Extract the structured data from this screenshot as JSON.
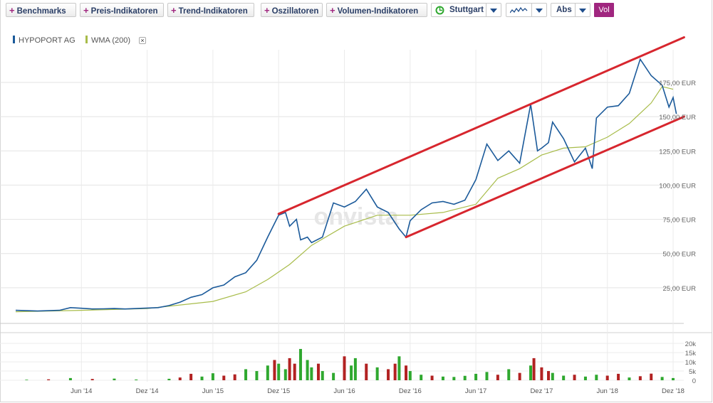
{
  "toolbar": {
    "benchmarks": "Benchmarks",
    "preis": "Preis-Indikatoren",
    "trend": "Trend-Indikatoren",
    "oszillatoren": "Oszillatoren",
    "volumen": "Volumen-Indikatoren",
    "exchange": "Stuttgart",
    "scale": "Abs",
    "vol": "Vol",
    "chart_type_icon": "line-chart-icon",
    "exchange_icon": "refresh-icon"
  },
  "legend": {
    "stock": "HYPOPORT AG",
    "wma": "WMA (200)",
    "remove": "×"
  },
  "watermark": "onvista",
  "colors": {
    "stock": "#1b5a9a",
    "wma": "#a8bc4a",
    "channel": "#d7262e",
    "vol_up": "#2fa82f",
    "vol_down": "#b22222",
    "accent": "#a0267f"
  },
  "chart_data": {
    "type": "line",
    "currency": "EUR",
    "y_ticks": [
      "25,00 EUR",
      "50,00 EUR",
      "75,00 EUR",
      "100,00 EUR",
      "125,00 EUR",
      "150,00 EUR",
      "175,00 EUR"
    ],
    "ylim": [
      0,
      175
    ],
    "x_ticks": [
      "Jun '14",
      "Dez '14",
      "Jun '15",
      "Dez '15",
      "Jun '16",
      "Dez '16",
      "Jun '17",
      "Dez '17",
      "Jun '18",
      "Dez '18"
    ],
    "xlim": [
      "2013-12",
      "2018-12"
    ],
    "series": [
      {
        "name": "HYPOPORT AG",
        "points": [
          [
            "2013-12",
            8.5
          ],
          [
            "2014-02",
            8.0
          ],
          [
            "2014-04",
            8.5
          ],
          [
            "2014-05",
            10.5
          ],
          [
            "2014-06",
            10
          ],
          [
            "2014-07",
            9.5
          ],
          [
            "2014-08",
            9.6
          ],
          [
            "2014-09",
            9.8
          ],
          [
            "2014-10",
            9.5
          ],
          [
            "2014-11",
            9.8
          ],
          [
            "2015-01",
            10.5
          ],
          [
            "2015-02",
            12
          ],
          [
            "2015-03",
            14.5
          ],
          [
            "2015-04",
            18
          ],
          [
            "2015-05",
            20
          ],
          [
            "2015-06",
            25
          ],
          [
            "2015-07",
            27
          ],
          [
            "2015-08",
            33
          ],
          [
            "2015-09",
            36
          ],
          [
            "2015-10",
            45
          ],
          [
            "2015-11",
            62
          ],
          [
            "2015-12",
            78
          ],
          [
            "2015-12-20",
            80
          ],
          [
            "2016-01",
            70
          ],
          [
            "2016-01-20",
            75
          ],
          [
            "2016-02",
            60
          ],
          [
            "2016-02-20",
            62
          ],
          [
            "2016-03",
            58
          ],
          [
            "2016-04",
            62
          ],
          [
            "2016-05",
            87
          ],
          [
            "2016-06",
            84
          ],
          [
            "2016-07",
            88
          ],
          [
            "2016-08",
            97
          ],
          [
            "2016-09",
            84
          ],
          [
            "2016-10",
            80
          ],
          [
            "2016-11",
            68
          ],
          [
            "2016-11-20",
            62
          ],
          [
            "2016-12",
            74
          ],
          [
            "2017-01",
            82
          ],
          [
            "2017-02",
            87
          ],
          [
            "2017-03",
            88
          ],
          [
            "2017-04",
            86
          ],
          [
            "2017-05",
            89
          ],
          [
            "2017-06",
            104
          ],
          [
            "2017-07",
            130
          ],
          [
            "2017-08",
            118
          ],
          [
            "2017-09",
            125
          ],
          [
            "2017-10",
            116
          ],
          [
            "2017-11",
            159
          ],
          [
            "2017-11-20",
            125
          ],
          [
            "2017-12",
            127
          ],
          [
            "2017-12-20",
            131
          ],
          [
            "2018-01",
            146
          ],
          [
            "2018-02",
            134
          ],
          [
            "2018-03",
            117
          ],
          [
            "2018-04",
            127
          ],
          [
            "2018-04-20",
            112
          ],
          [
            "2018-05",
            149
          ],
          [
            "2018-06",
            157
          ],
          [
            "2018-07",
            158
          ],
          [
            "2018-08",
            167
          ],
          [
            "2018-09",
            192
          ],
          [
            "2018-10",
            180
          ],
          [
            "2018-11",
            173
          ],
          [
            "2018-11-20",
            157
          ],
          [
            "2018-12",
            164
          ],
          [
            "2018-12-10",
            152
          ]
        ]
      },
      {
        "name": "WMA (200)",
        "points": [
          [
            "2013-12",
            7.5
          ],
          [
            "2014-06",
            8.5
          ],
          [
            "2014-12",
            9.8
          ],
          [
            "2015-06",
            15
          ],
          [
            "2015-09",
            22
          ],
          [
            "2015-11",
            31
          ],
          [
            "2016-01",
            42
          ],
          [
            "2016-03",
            56
          ],
          [
            "2016-06",
            70
          ],
          [
            "2016-09",
            78
          ],
          [
            "2016-12",
            78
          ],
          [
            "2017-03",
            80
          ],
          [
            "2017-06",
            86
          ],
          [
            "2017-08",
            105
          ],
          [
            "2017-10",
            112
          ],
          [
            "2017-12",
            122
          ],
          [
            "2018-02",
            127
          ],
          [
            "2018-04",
            128
          ],
          [
            "2018-06",
            135
          ],
          [
            "2018-08",
            145
          ],
          [
            "2018-10",
            160
          ],
          [
            "2018-11",
            172
          ],
          [
            "2018-12",
            170
          ]
        ]
      }
    ],
    "channel_lines": [
      {
        "from": [
          "2015-12",
          79
        ],
        "to": [
          "2019-01",
          208
        ]
      },
      {
        "from": [
          "2016-11-20",
          62
        ],
        "to": [
          "2019-01",
          150
        ]
      }
    ],
    "volume": {
      "y_ticks": [
        "0",
        "5k",
        "10k",
        "15k",
        "20k"
      ],
      "ylim": [
        0,
        22000
      ],
      "bars": [
        [
          "2014-01",
          300,
          "u"
        ],
        [
          "2014-03",
          500,
          "d"
        ],
        [
          "2014-05",
          1200,
          "u"
        ],
        [
          "2014-07",
          700,
          "d"
        ],
        [
          "2014-09",
          900,
          "u"
        ],
        [
          "2014-11",
          400,
          "u"
        ],
        [
          "2015-02",
          800,
          "u"
        ],
        [
          "2015-03",
          1500,
          "d"
        ],
        [
          "2015-04",
          3500,
          "d"
        ],
        [
          "2015-05",
          2000,
          "u"
        ],
        [
          "2015-06",
          3800,
          "u"
        ],
        [
          "2015-07",
          2500,
          "d"
        ],
        [
          "2015-08",
          3200,
          "d"
        ],
        [
          "2015-09",
          6000,
          "u"
        ],
        [
          "2015-10",
          5000,
          "u"
        ],
        [
          "2015-11",
          8000,
          "u"
        ],
        [
          "2015-11-20",
          11000,
          "d"
        ],
        [
          "2015-12",
          9000,
          "u"
        ],
        [
          "2015-12-20",
          6000,
          "u"
        ],
        [
          "2016-01",
          12000,
          "d"
        ],
        [
          "2016-01-15",
          9000,
          "d"
        ],
        [
          "2016-02",
          17000,
          "u"
        ],
        [
          "2016-02-20",
          11000,
          "u"
        ],
        [
          "2016-03",
          7000,
          "u"
        ],
        [
          "2016-03-20",
          9000,
          "d"
        ],
        [
          "2016-04",
          5000,
          "u"
        ],
        [
          "2016-05",
          4000,
          "u"
        ],
        [
          "2016-06",
          13000,
          "d"
        ],
        [
          "2016-06-20",
          8000,
          "u"
        ],
        [
          "2016-07",
          12000,
          "u"
        ],
        [
          "2016-08",
          9000,
          "d"
        ],
        [
          "2016-09",
          7000,
          "u"
        ],
        [
          "2016-10",
          6000,
          "d"
        ],
        [
          "2016-10-20",
          9000,
          "d"
        ],
        [
          "2016-11",
          13000,
          "u"
        ],
        [
          "2016-11-20",
          8000,
          "d"
        ],
        [
          "2016-12",
          5000,
          "u"
        ],
        [
          "2017-01",
          3000,
          "u"
        ],
        [
          "2017-02",
          2500,
          "d"
        ],
        [
          "2017-03",
          2000,
          "u"
        ],
        [
          "2017-04",
          1800,
          "u"
        ],
        [
          "2017-05",
          2400,
          "u"
        ],
        [
          "2017-06",
          3500,
          "u"
        ],
        [
          "2017-07",
          4500,
          "u"
        ],
        [
          "2017-08",
          3000,
          "d"
        ],
        [
          "2017-09",
          6000,
          "u"
        ],
        [
          "2017-10",
          4000,
          "d"
        ],
        [
          "2017-11",
          8000,
          "u"
        ],
        [
          "2017-11-10",
          12000,
          "d"
        ],
        [
          "2017-12",
          7000,
          "d"
        ],
        [
          "2017-12-20",
          5000,
          "d"
        ],
        [
          "2018-01",
          4000,
          "u"
        ],
        [
          "2018-02",
          2500,
          "u"
        ],
        [
          "2018-03",
          3000,
          "d"
        ],
        [
          "2018-04",
          2000,
          "u"
        ],
        [
          "2018-05",
          3000,
          "u"
        ],
        [
          "2018-06",
          2500,
          "d"
        ],
        [
          "2018-07",
          3500,
          "d"
        ],
        [
          "2018-08",
          1500,
          "u"
        ],
        [
          "2018-09",
          2200,
          "d"
        ],
        [
          "2018-10",
          3600,
          "d"
        ],
        [
          "2018-11",
          1800,
          "u"
        ],
        [
          "2018-12",
          1200,
          "u"
        ]
      ]
    }
  }
}
